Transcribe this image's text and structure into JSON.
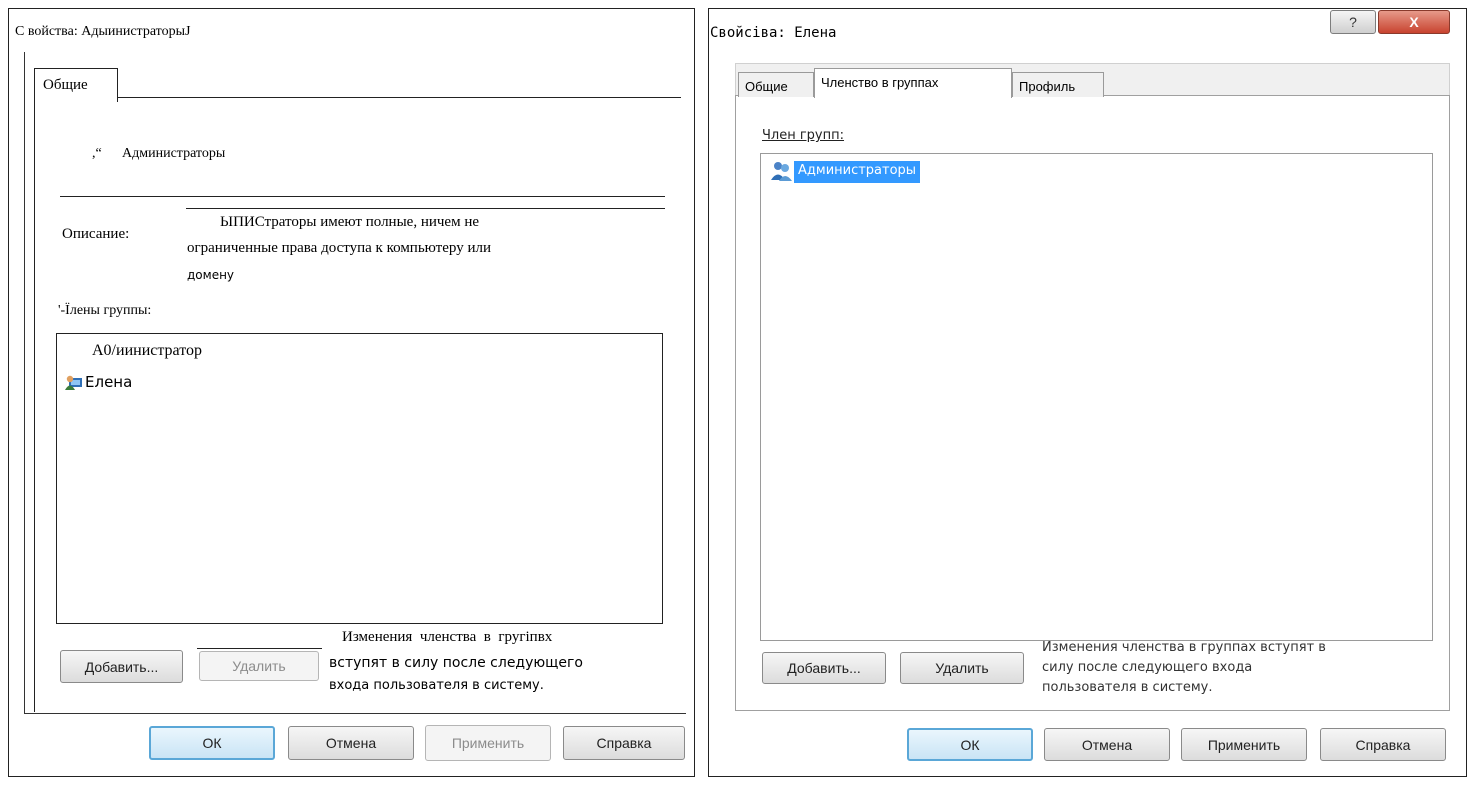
{
  "left": {
    "title": "С войства: АдыинистраторыJ",
    "tab_label": "Общие",
    "group_prefix": ",“",
    "group_name": "Администраторы",
    "description_label": "Описание:",
    "description_lines": [
      "ЫПИСтраторы имеют полные, ничем не",
      "ограниченные права доступа к компьютеру или",
      "домену"
    ],
    "members_label": "'-Ïлены группы:",
    "members": [
      "А0/иинистратор",
      "Елена"
    ],
    "add_button": "Добавить...",
    "remove_button": "Удалить",
    "note_lines": [
      "Изменения  членства  в  гругiпвх",
      "вступят в силу после следующего",
      "входа пользователя в систему."
    ],
    "ok_button": "ОК",
    "cancel_button": "Отмена",
    "apply_button": "Применить",
    "help_button": "Справка"
  },
  "right": {
    "title": "Свойсiва: Елена",
    "help_icon_glyph": "?",
    "close_icon_glyph": "X",
    "tabs": [
      "Общие",
      "Членство в группах",
      "Профиль"
    ],
    "members_label": "Член групп:",
    "groups": [
      "Администраторы"
    ],
    "add_button": "Добавить...",
    "remove_button": "Удалить",
    "note_lines": [
      "Изменения членства в группах вступят в",
      "силу после следующего входа",
      "пользователя в систему."
    ],
    "ok_button": "ОК",
    "cancel_button": "Отмена",
    "apply_button": "Применить",
    "help_button": "Справка"
  },
  "colors": {
    "selection": "#3399ff",
    "primary_button_border": "#5aa7d7",
    "close_button": "#c8432f"
  },
  "icons": {
    "user": "user-icon",
    "group": "group-icon",
    "help": "help-icon",
    "close": "close-icon"
  }
}
